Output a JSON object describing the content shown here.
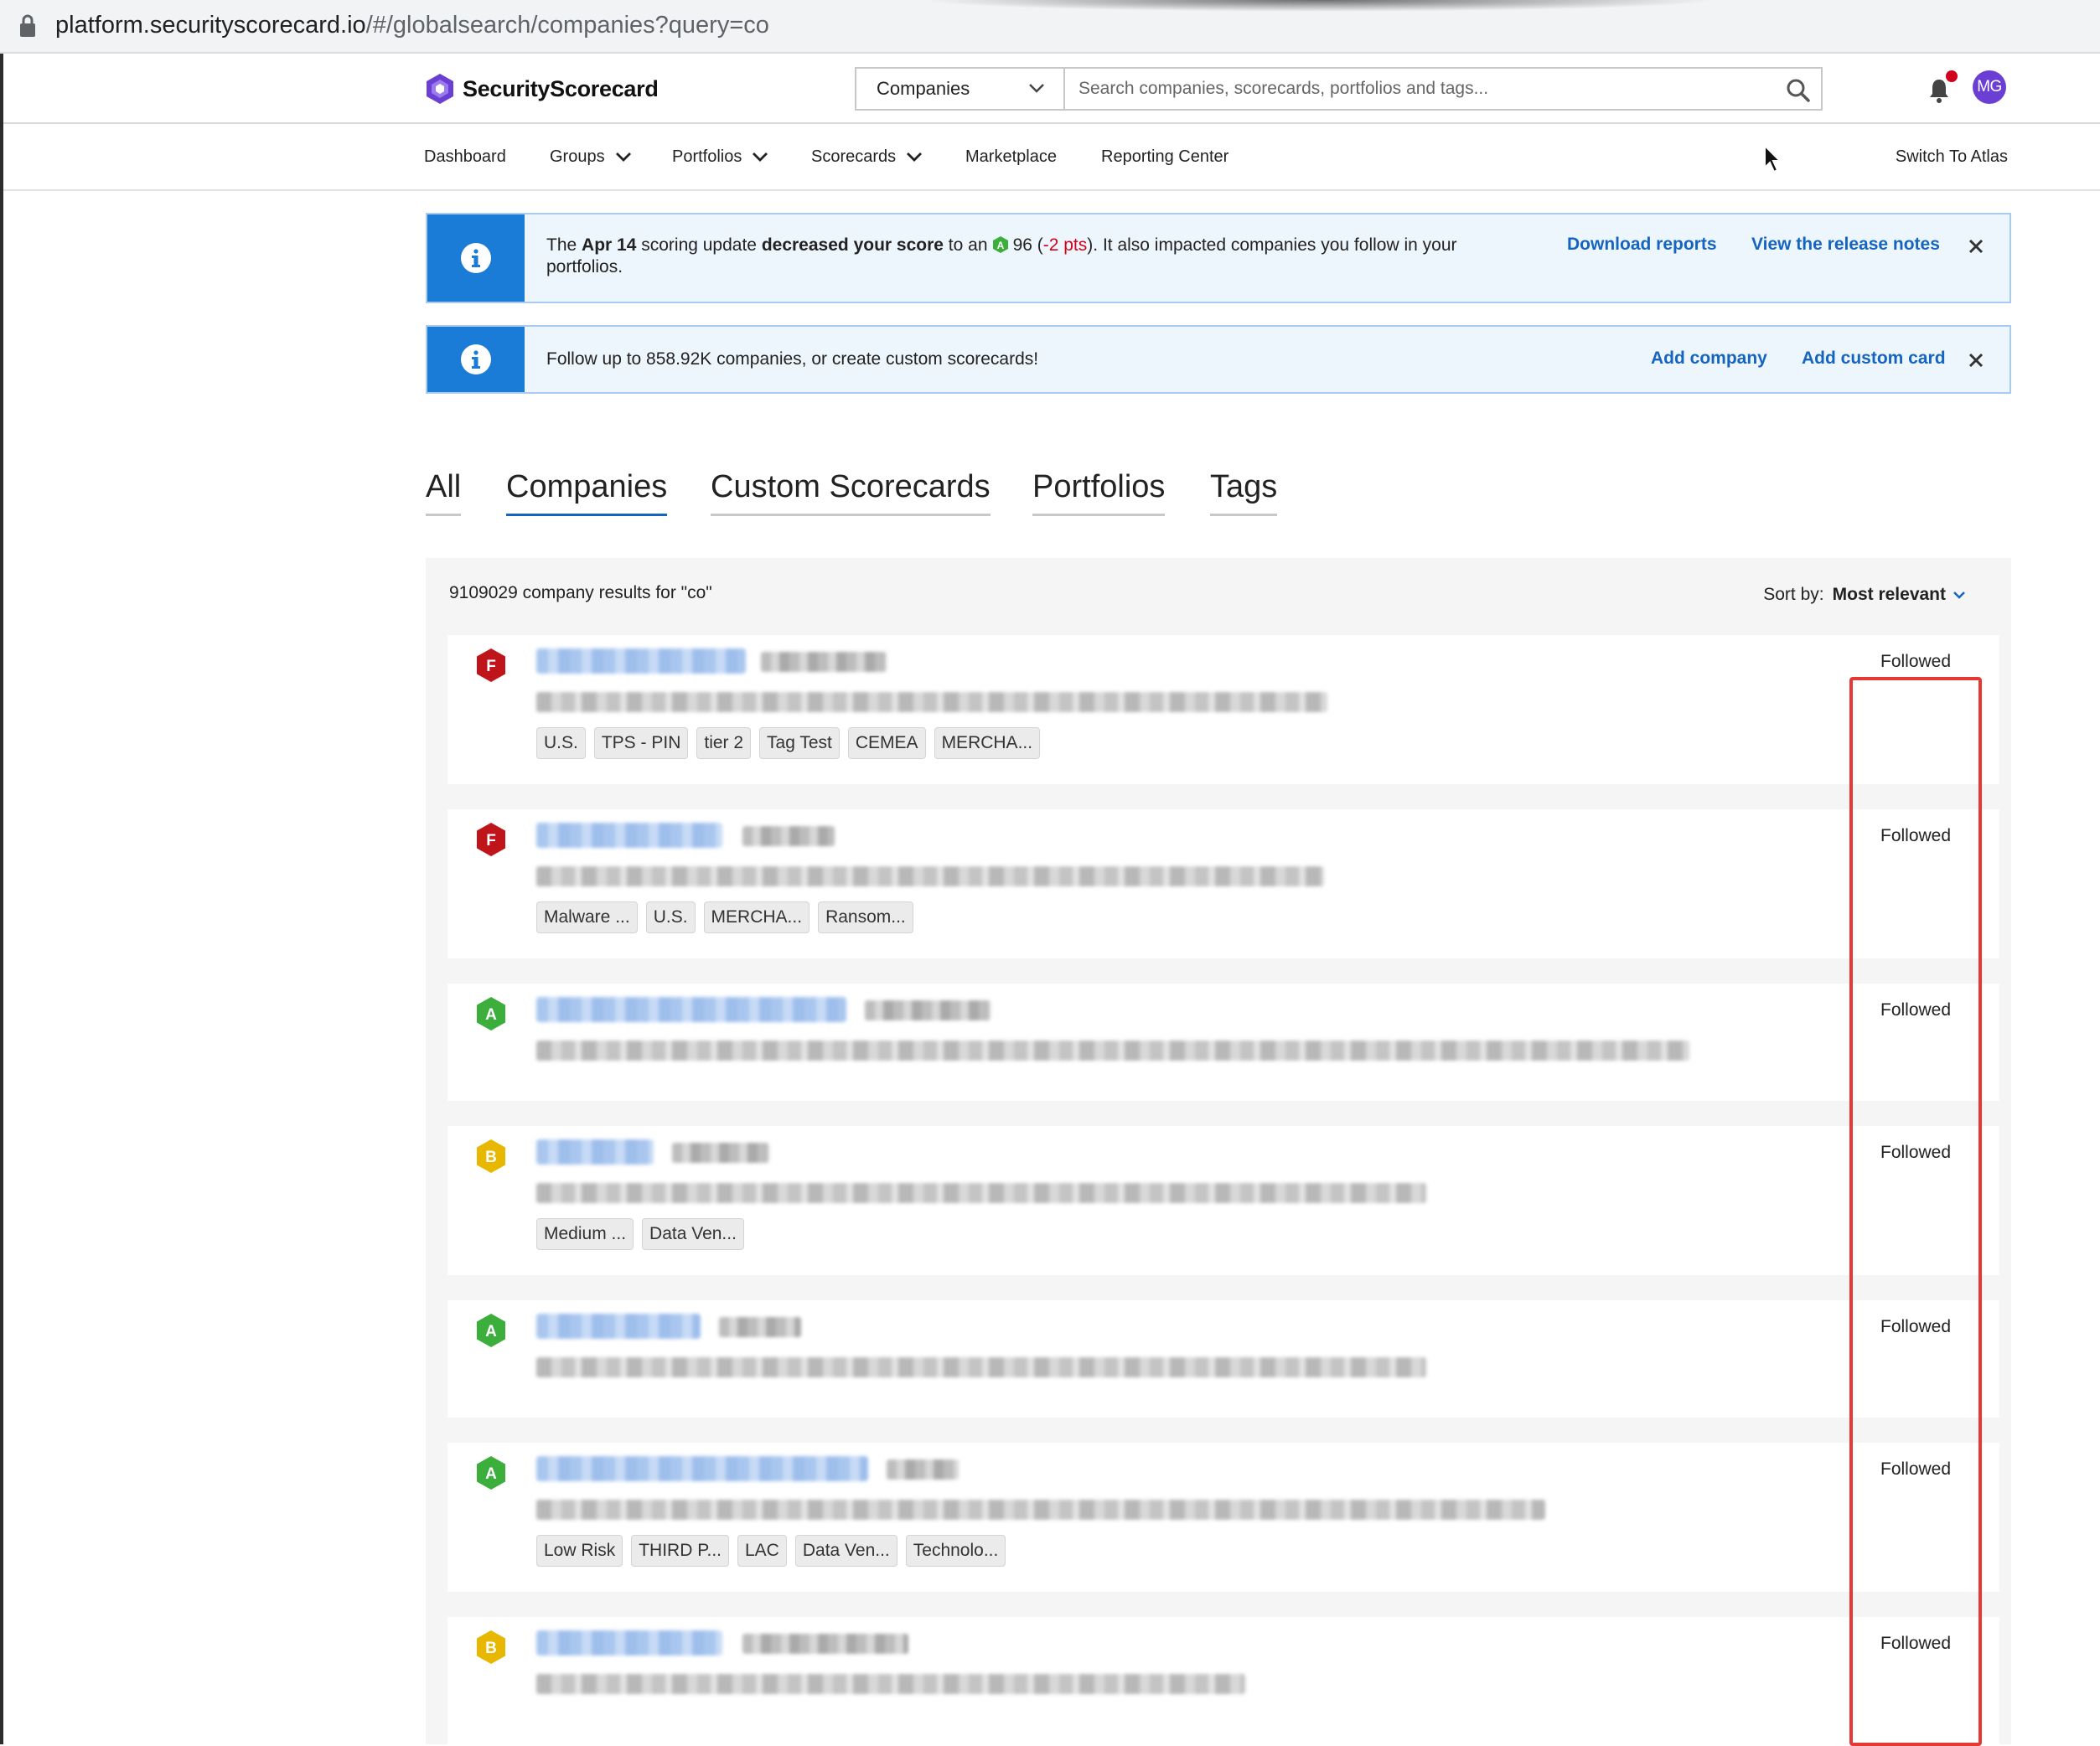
{
  "browser": {
    "url_host": "platform.securityscorecard.io",
    "url_path": "/#/globalsearch/companies?query=co"
  },
  "header": {
    "brand": "SecurityScorecard",
    "scope_selected": "Companies",
    "search_placeholder": "Search companies, scorecards, portfolios and tags...",
    "avatar_initials": "MG"
  },
  "nav": {
    "items": [
      {
        "label": "Dashboard",
        "dropdown": false
      },
      {
        "label": "Groups",
        "dropdown": true
      },
      {
        "label": "Portfolios",
        "dropdown": true
      },
      {
        "label": "Scorecards",
        "dropdown": true
      },
      {
        "label": "Marketplace",
        "dropdown": false
      },
      {
        "label": "Reporting Center",
        "dropdown": false
      }
    ],
    "switch_label": "Switch To Atlas"
  },
  "banner_score": {
    "t1": "The ",
    "date": "Apr 14",
    "t2": " scoring update ",
    "emph": "decreased your score",
    "t3": " to an ",
    "grade": "A",
    "score": "96",
    "open": " (",
    "delta": "-2 pts",
    "t4": "). It also impacted companies you follow in your",
    "t5": "portfolios.",
    "action1": "Download reports",
    "action2": "View the release notes"
  },
  "banner_follow": {
    "text": "Follow up to 858.92K companies, or create custom scorecards!",
    "action1": "Add company",
    "action2": "Add custom card"
  },
  "tabs": [
    "All",
    "Companies",
    "Custom Scorecards",
    "Portfolios",
    "Tags"
  ],
  "active_tab": "Companies",
  "results": {
    "count_text": "9109029 company results for \"co\"",
    "sort_label": "Sort by:",
    "sort_value": "Most relevant",
    "rows": [
      {
        "grade": "F",
        "tags": [
          "U.S.",
          "TPS - PIN",
          "tier 2",
          "Tag Test",
          "CEMEA",
          "MERCHA..."
        ],
        "status": "Followed"
      },
      {
        "grade": "F",
        "tags": [
          "Malware ...",
          "U.S.",
          "MERCHA...",
          "Ransom..."
        ],
        "status": "Followed"
      },
      {
        "grade": "A",
        "tags": [],
        "status": "Followed"
      },
      {
        "grade": "B",
        "tags": [
          "Medium ...",
          "Data Ven..."
        ],
        "status": "Followed"
      },
      {
        "grade": "A",
        "tags": [],
        "status": "Followed"
      },
      {
        "grade": "A",
        "tags": [
          "Low Risk",
          "THIRD P...",
          "LAC",
          "Data Ven...",
          "Technolo..."
        ],
        "status": "Followed"
      },
      {
        "grade": "B",
        "tags": [],
        "status": "Followed"
      }
    ]
  },
  "colors": {
    "grade_A": "#3cae3c",
    "grade_B": "#e8b800",
    "grade_F": "#c0141b",
    "link": "#1565c0",
    "banner_strip": "#1a7cd6",
    "highlight": "#e53935"
  }
}
